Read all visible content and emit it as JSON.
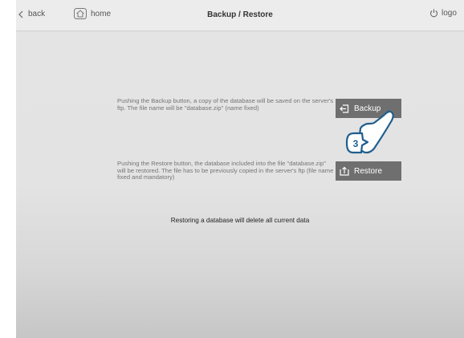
{
  "header": {
    "back_label": "back",
    "home_label": "home",
    "title": "Backup / Restore",
    "logout_label": "logo"
  },
  "backup": {
    "description": "Pushing the Backup button, a copy of the database will be saved on the server's ftp. The file name will be \"database.zip\" (name fixed)",
    "button_label": "Backup"
  },
  "restore": {
    "description": "Pushing the Restore button, the database included into the file \"database.zip\" will be restored. The file has to be previously copied in the server's ftp (file name fixed and mandatory)",
    "button_label": "Restore"
  },
  "warning": "Restoring a database will delete all current data",
  "callout": {
    "step_number": "3",
    "color": "#1f5e8e"
  },
  "icons": [
    "chevron-left-icon",
    "home-icon",
    "power-icon",
    "backup-icon",
    "restore-icon",
    "pointer-hand-icon"
  ]
}
